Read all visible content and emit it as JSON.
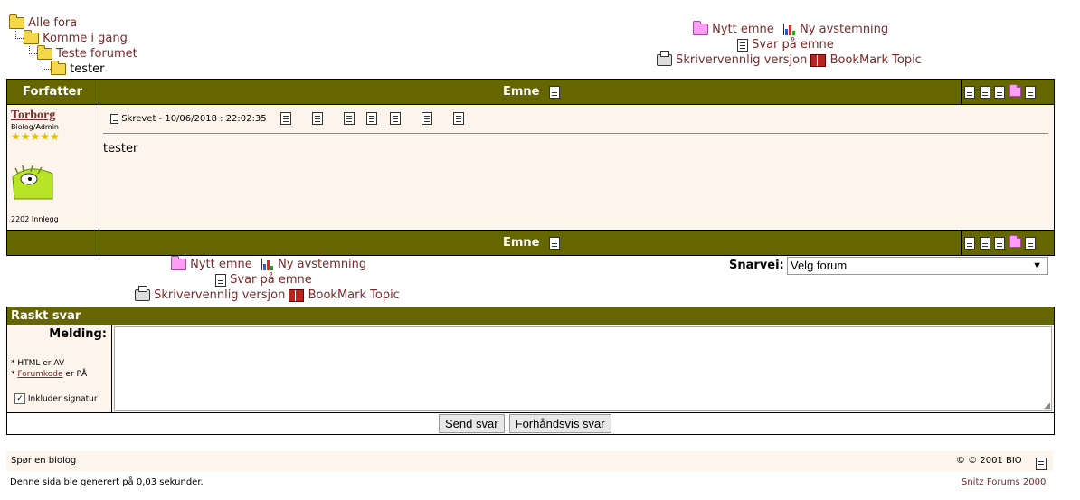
{
  "breadcrumb": [
    "Alle fora",
    "Komme i gang",
    "Teste forumet",
    "tester"
  ],
  "top_links": {
    "new_topic": "Nytt emne",
    "new_poll": "Ny avstemning",
    "reply": "Svar på emne",
    "print": "Skrivervennlig versjon",
    "bookmark": "BookMark Topic"
  },
  "table": {
    "author_header": "Forfatter",
    "topic_header": "Emne"
  },
  "post": {
    "author": "Torborg",
    "role": "Biolog/Admin",
    "post_count": "2202 Innlegg",
    "posted_label": "Skrevet - 10/06/2018 :  22:02:35",
    "body": "tester"
  },
  "jump": {
    "label": "Snarvei:",
    "selected": "Velg forum"
  },
  "quick_reply": {
    "title": "Raskt svar",
    "message_label": "Melding:",
    "html_note": "* HTML er AV",
    "forum_code_prefix": "* ",
    "forum_code_link": "Forumkode",
    "forum_code_suffix": " er PÅ",
    "signature_label": "Inkluder signatur",
    "send_label": "Send svar",
    "preview_label": "Forhåndsvis svar"
  },
  "footer": {
    "site": "Spør en biolog",
    "copyright": "© © 2001 BIO",
    "generated": "Denne sida ble generert på 0,03 sekunder.",
    "powered": "Snitz Forums 2000"
  },
  "colors": {
    "bar": "#666600",
    "post_bg": "#fdf5ec",
    "link": "#7a2b2b"
  }
}
